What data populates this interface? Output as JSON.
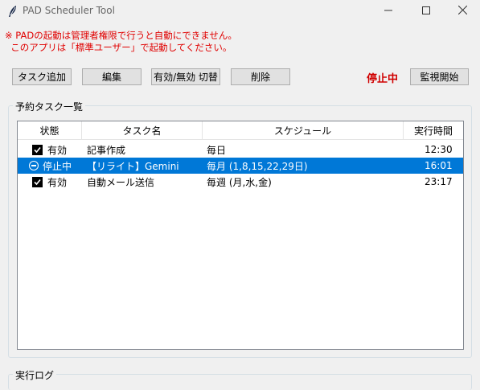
{
  "window": {
    "title": "PAD Scheduler Tool",
    "icon": "feather-icon"
  },
  "warning": {
    "line1": "※ PADの起動は管理者権限で行うと自動にできません。",
    "line2": "  このアプリは「標準ユーザー」で起動してください。"
  },
  "toolbar": {
    "add_label": "タスク追加",
    "edit_label": "編集",
    "toggle_label": "有効/無効 切替",
    "delete_label": "削除",
    "status_text": "停止中",
    "monitor_label": "監視開始"
  },
  "task_group": {
    "label": "予約タスク一覧",
    "columns": [
      "状態",
      "タスク名",
      "スケジュール",
      "実行時間"
    ],
    "rows": [
      {
        "state": "有効",
        "state_icon": "checkbox-checked-icon",
        "name": "記事作成",
        "schedule": "毎日",
        "time": "12:30",
        "selected": false
      },
      {
        "state": "停止中",
        "state_icon": "minus-circle-icon",
        "name": "【リライト】Gemini",
        "schedule": "毎月 (1,8,15,22,29日)",
        "time": "16:01",
        "selected": true
      },
      {
        "state": "有効",
        "state_icon": "checkbox-checked-icon",
        "name": "自動メール送信",
        "schedule": "毎週 (月,水,金)",
        "time": "23:17",
        "selected": false
      }
    ]
  },
  "log_group": {
    "label": "実行ログ"
  },
  "colors": {
    "warning": "#e00000",
    "status_stopped": "#d00000",
    "selection": "#0078d7"
  }
}
